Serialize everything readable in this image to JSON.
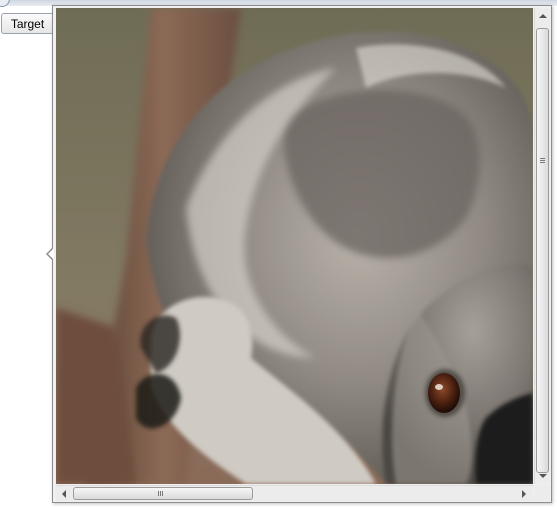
{
  "target_button": {
    "label": "Target"
  },
  "image": {
    "subject": "koala-photo"
  },
  "scrollbars": {
    "vertical": {
      "position": 0.0,
      "visible_fraction": 0.96
    },
    "horizontal": {
      "position": 0.0,
      "visible_fraction": 0.38
    }
  },
  "colors": {
    "background": "#7c7660",
    "fur_gray": "#8a8580",
    "fur_light": "#d9d6d0",
    "branch": "#7a5a48",
    "eye": "#3a1c10"
  }
}
